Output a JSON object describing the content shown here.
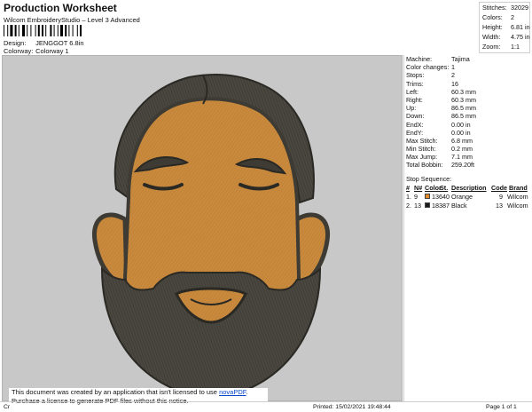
{
  "header": {
    "title": "Production Worksheet",
    "subtitle": "Wilcom EmbroideryStudio – Level 3 Advanced",
    "design_label": "Design:",
    "design_value": "JENGGOT 6.8in",
    "colorway_label": "Colorway:",
    "colorway_value": "Colorway 1"
  },
  "stats": [
    {
      "k": "Stitches:",
      "v": "32029"
    },
    {
      "k": "Colors:",
      "v": "2"
    },
    {
      "k": "Height:",
      "v": "6.81 in"
    },
    {
      "k": "Width:",
      "v": "4.75 in"
    },
    {
      "k": "Zoom:",
      "v": "1:1"
    }
  ],
  "machine_info": [
    {
      "k": "Machine:",
      "v": "Tajima"
    },
    {
      "k": "Color changes:",
      "v": "1"
    },
    {
      "k": "Stops:",
      "v": "2"
    },
    {
      "k": "Trims:",
      "v": "16"
    },
    {
      "k": "Left:",
      "v": "60.3 mm"
    },
    {
      "k": "Right:",
      "v": "60.3 mm"
    },
    {
      "k": "Up:",
      "v": "86.5 mm"
    },
    {
      "k": "Down:",
      "v": "86.5 mm"
    },
    {
      "k": "EndX:",
      "v": "0.00 in"
    },
    {
      "k": "EndY:",
      "v": "0.00 in"
    },
    {
      "k": "Max Stitch:",
      "v": "6.8 mm"
    },
    {
      "k": "Min Stitch:",
      "v": "0.2 mm"
    },
    {
      "k": "Max Jump:",
      "v": "7.1 mm"
    },
    {
      "k": "Total Bobbin:",
      "v": "259.20ft"
    }
  ],
  "stop_sequence": {
    "title": "Stop Sequence:",
    "headers": {
      "num": "#",
      "n": "N#",
      "color": "Color",
      "st": "St.",
      "desc": "Description",
      "code": "Code",
      "brand": "Brand"
    },
    "rows": [
      {
        "num": "1.",
        "n": "9",
        "hex": "#e08a2c",
        "st": "13640",
        "desc": "Orange",
        "code": "9",
        "brand": "Wilcom"
      },
      {
        "num": "2.",
        "n": "13",
        "hex": "#1a1a1a",
        "st": "18387",
        "desc": "Black",
        "code": "13",
        "brand": "Wilcom"
      }
    ]
  },
  "notice": {
    "line1_prefix": "This document was created by an application that isn't licensed to use ",
    "link": "novaPDF",
    "line1_suffix": ".",
    "line2": "Purchase a license to generate PDF files without this notice."
  },
  "footer": {
    "left": "Cr",
    "printed": "Printed: 15/02/2021 19:48:44",
    "page": "Page 1 of 1"
  },
  "colors": {
    "skin": "#c98a3e",
    "outline": "#3d3b33",
    "beard": "#4a4740",
    "background": "#c8c8c8"
  }
}
